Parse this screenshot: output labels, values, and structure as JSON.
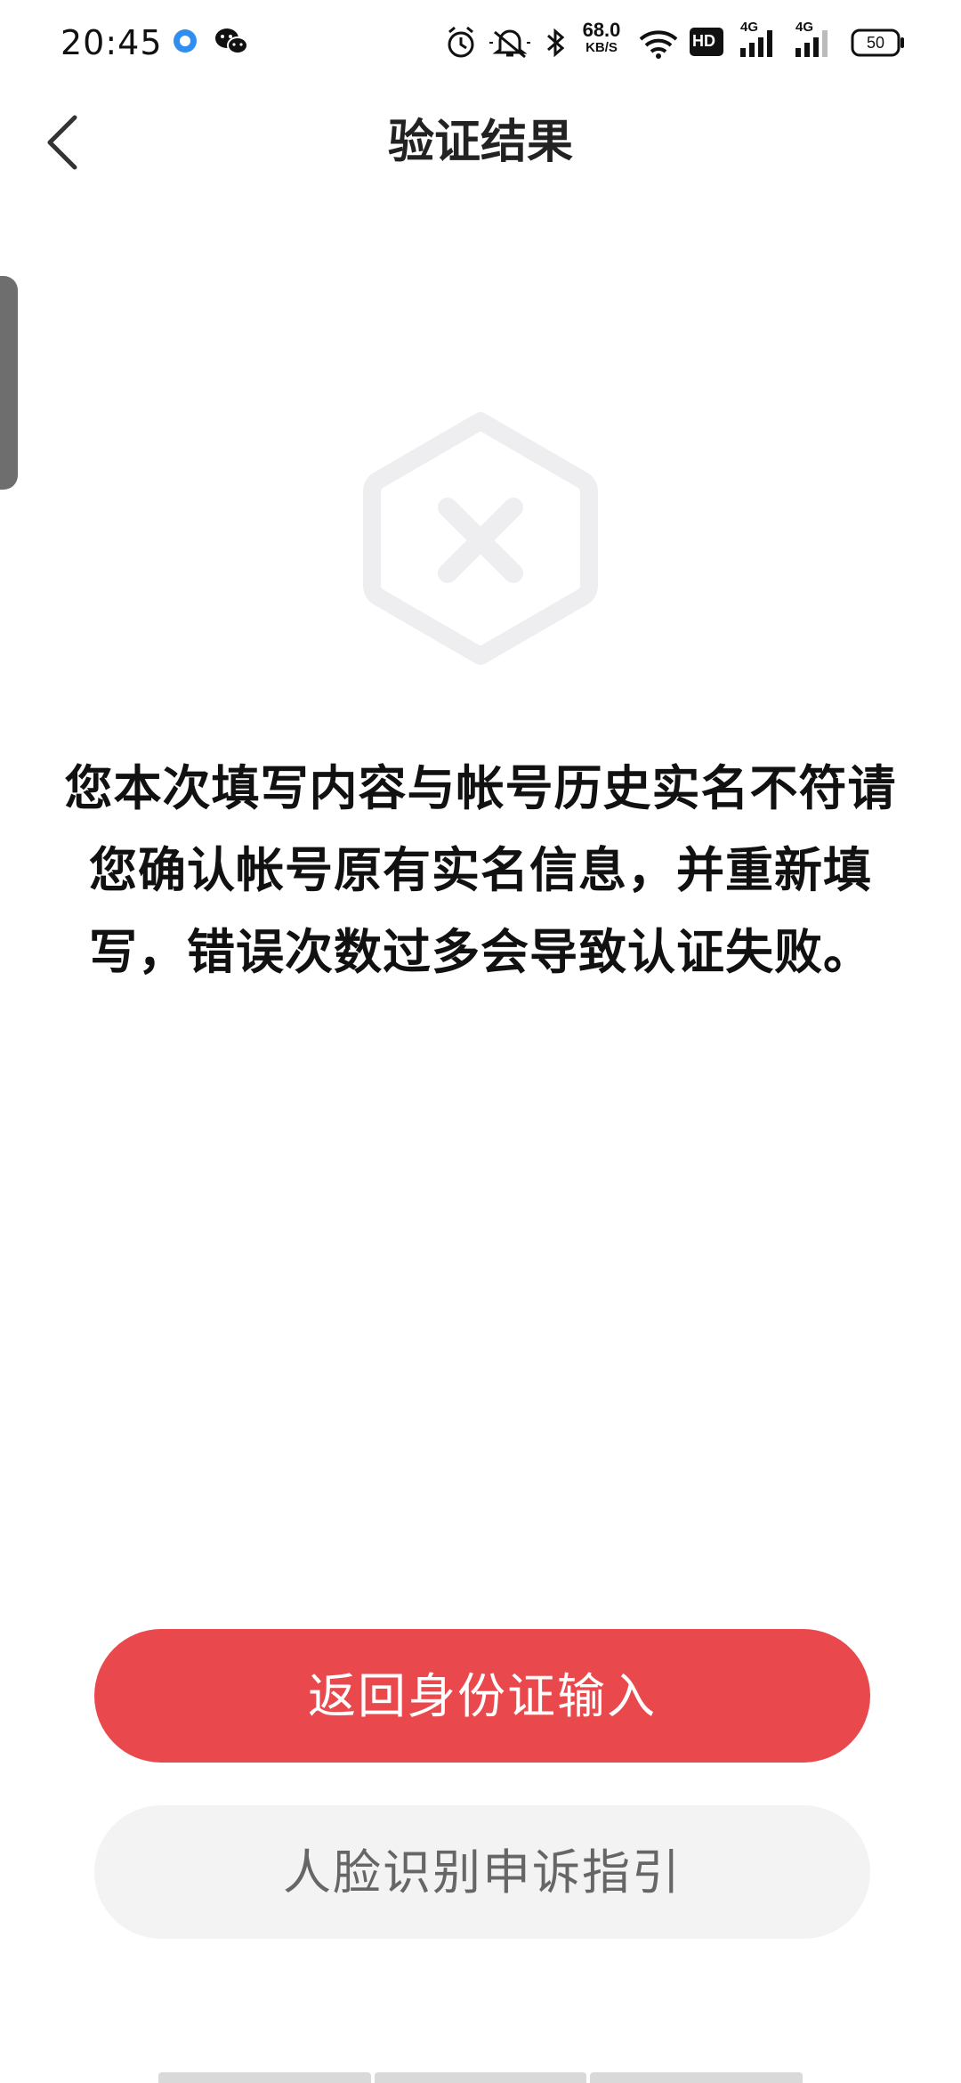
{
  "status_bar": {
    "time": "20:45",
    "left_icons": [
      "blue-dot-app-icon",
      "wechat-icon"
    ],
    "right_icons": [
      "alarm-icon",
      "mute-icon",
      "bluetooth-icon",
      "network-speed",
      "wifi-icon",
      "hd-icon",
      "signal-4g-icon",
      "signal-4g-2-icon",
      "battery-icon"
    ],
    "network_speed_value": "68.0",
    "network_speed_unit": "KB/S",
    "hd_label": "HD",
    "signal_label_1": "4G",
    "signal_label_2": "4G",
    "battery_level": "50"
  },
  "header": {
    "title": "验证结果"
  },
  "result": {
    "icon": "fail-hexagon-x-icon",
    "message_lines": [
      "您本次填写内容与帐号历史实名不符请",
      "您确认帐号原有实名信息，并重新填",
      "写，错误次数过多会导致认证失败。"
    ]
  },
  "actions": {
    "primary_label": "返回身份证输入",
    "secondary_label": "人脸识别申诉指引"
  },
  "colors": {
    "primary": "#e9494c",
    "secondary_bg": "#f3f3f3",
    "icon_gray": "#eeeef0"
  }
}
